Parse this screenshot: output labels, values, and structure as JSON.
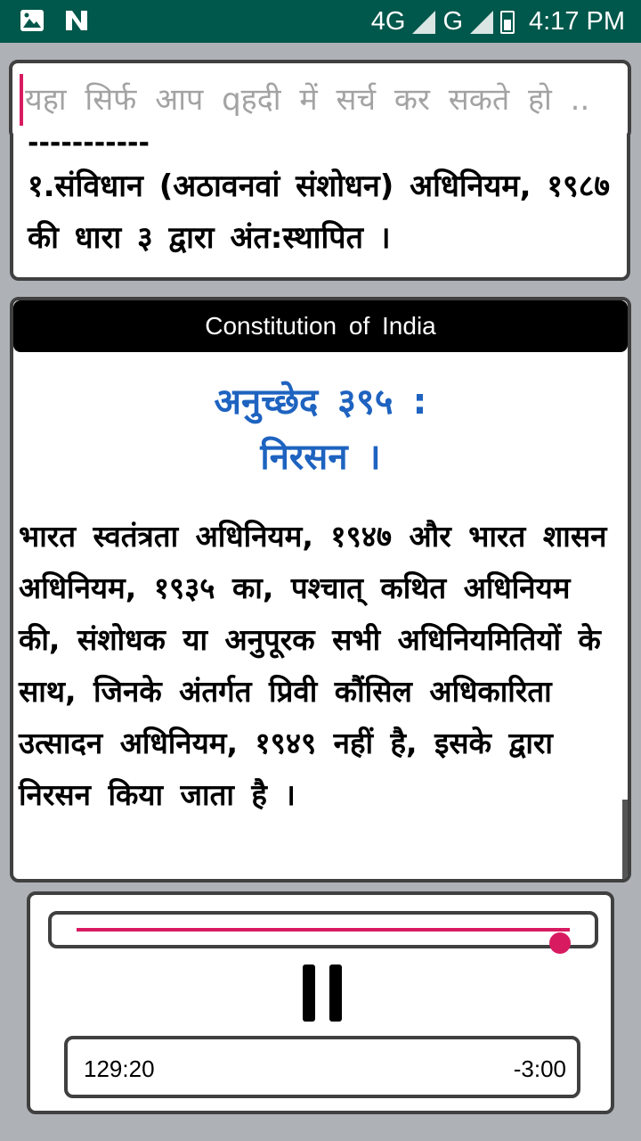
{
  "status_bar": {
    "time": "4:17 PM",
    "network_1": "4G",
    "network_2": "G",
    "icons": [
      "image-icon",
      "n-app-icon",
      "signal-icon",
      "battery-icon"
    ]
  },
  "search": {
    "placeholder": "यहा सिर्फ आप qहदी में सर्च कर सकते हो .."
  },
  "previous_card": {
    "dashes": "-----------",
    "text": "१.संविधान (अठावनवां संशोधन) अधिनियम, १९८७ की धारा ३ द्वारा अंत:स्थापित ।"
  },
  "article": {
    "header": "Constitution of India",
    "number": "अनुच्छेद ३९५ :",
    "title": "निरसन ।",
    "body": "भारत स्वतंत्रता अधिनियम, १९४७ और भारत शासन अधिनियम, १९३५ का, पश्चात् कथित अधिनियम की, संशोधक या अनुपूरक सभी अधिनियमितियों के साथ, जिनके अंतर्गत प्रिवी कौंसिल अधिकारिता उत्सादन अधिनियम, १९४९ नहीं है, इसके द्वारा निरसन किया जाता है ।"
  },
  "player": {
    "progress": 0.98,
    "elapsed": "129:20",
    "remaining": "-3:00"
  },
  "colors": {
    "status_bar": "#00574b",
    "accent": "#d81b60",
    "article_heading": "#1e63c0"
  }
}
